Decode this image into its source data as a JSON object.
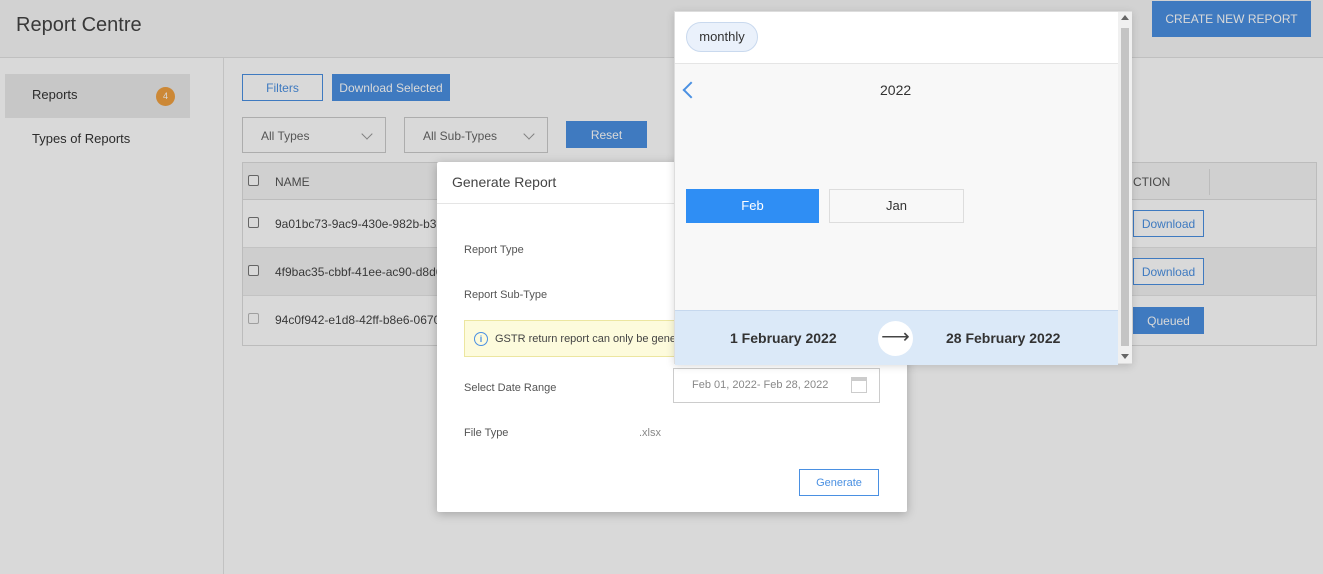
{
  "header": {
    "title": "Report Centre",
    "create_button": "CREATE NEW REPORT"
  },
  "sidebar": {
    "items": [
      {
        "label": "Reports",
        "badge": "4"
      },
      {
        "label": "Types of Reports"
      }
    ]
  },
  "toolbar": {
    "filters_label": "Filters",
    "download_selected_label": "Download Selected",
    "type_select": "All Types",
    "subtype_select": "All Sub-Types",
    "reset_label": "Reset"
  },
  "table": {
    "columns": [
      "NAME",
      "CTION"
    ],
    "rows": [
      {
        "name": "9a01bc73-9ac9-430e-982b-b33",
        "action": "Download"
      },
      {
        "name": "4f9bac35-cbbf-41ee-ac90-d8d6",
        "action": "Download"
      },
      {
        "name": "94c0f942-e1d8-42ff-b8e6-0670",
        "action": "Queued"
      }
    ]
  },
  "modal": {
    "title": "Generate Report",
    "report_type_label": "Report Type",
    "report_subtype_label": "Report Sub-Type",
    "info_text": "GSTR return report can only be gene",
    "date_range_label": "Select Date Range",
    "date_range_value": "Feb 01, 2022- Feb 28, 2022",
    "file_type_label": "File Type",
    "file_type_value": ".xlsx",
    "generate_label": "Generate"
  },
  "picker": {
    "mode": "monthly",
    "year": "2022",
    "months": [
      "Feb",
      "Jan"
    ],
    "selected_month": "Feb",
    "range_start": "1 February 2022",
    "range_end": "28 February 2022",
    "arrow": "⟶"
  },
  "colors": {
    "accent": "#4a90e2",
    "selected": "#2f8ef4",
    "badge": "#f0a040",
    "range_bg": "#dbe9f8"
  }
}
